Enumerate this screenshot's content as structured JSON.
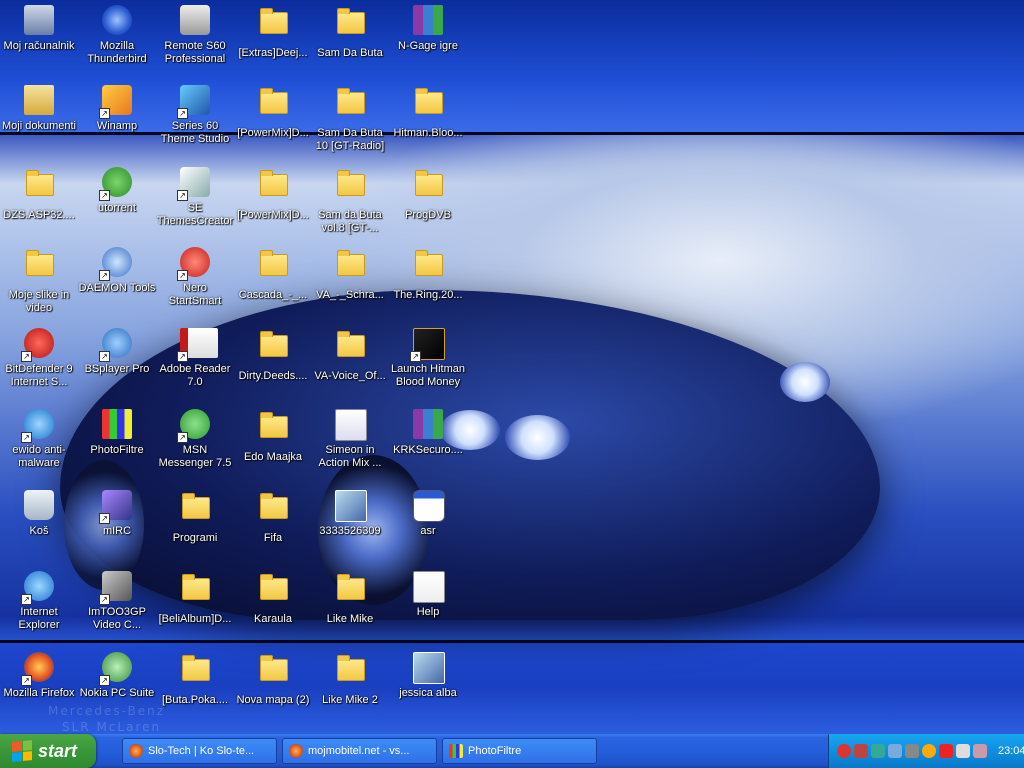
{
  "desktop": {
    "icons": [
      {
        "label": "Moj računalnik",
        "type": "computer"
      },
      {
        "label": "Mozilla Thunderbird",
        "type": "thunderbird"
      },
      {
        "label": "Remote S60 Professional",
        "type": "remote"
      },
      {
        "label": "[Extras]Deej...",
        "type": "folder"
      },
      {
        "label": "Sam Da Buta",
        "type": "folder"
      },
      {
        "label": "N-Gage igre",
        "type": "winrar"
      },
      {
        "label": "Moji dokumenti",
        "type": "docs"
      },
      {
        "label": "Winamp",
        "type": "winamp"
      },
      {
        "label": "Series 60 Theme Studio",
        "type": "theme"
      },
      {
        "label": "[PowerMix]D...",
        "type": "folder"
      },
      {
        "label": "Sam Da Buta 10 [GT-Radio]",
        "type": "folder"
      },
      {
        "label": "Hitman.Bloo...",
        "type": "folder"
      },
      {
        "label": "DZS.ASP32....",
        "type": "folder"
      },
      {
        "label": "utorrent",
        "type": "utorrent"
      },
      {
        "label": "SE ThemesCreator",
        "type": "se"
      },
      {
        "label": "[PowerMix]D...",
        "type": "folder"
      },
      {
        "label": "Sam da Buta vol.8 [GT-...",
        "type": "folder"
      },
      {
        "label": "ProgDVB",
        "type": "folder"
      },
      {
        "label": "Moje slike in video",
        "type": "folder"
      },
      {
        "label": "DAEMON Tools",
        "type": "daemon"
      },
      {
        "label": "Nero StartSmart",
        "type": "nero"
      },
      {
        "label": "Cascada_-_...",
        "type": "folder"
      },
      {
        "label": "VA_-_Schra...",
        "type": "folder"
      },
      {
        "label": "The.Ring.20...",
        "type": "folder"
      },
      {
        "label": "BitDefender 9 Internet S...",
        "type": "bitdefender"
      },
      {
        "label": "BSplayer Pro",
        "type": "bsplayer"
      },
      {
        "label": "Adobe Reader 7.0",
        "type": "adobe"
      },
      {
        "label": "Dirty.Deeds....",
        "type": "folder"
      },
      {
        "label": "VA-Voice_Of...",
        "type": "folder"
      },
      {
        "label": "Launch Hitman Blood Money",
        "type": "hitman"
      },
      {
        "label": "ewido anti-malware",
        "type": "ewido"
      },
      {
        "label": "PhotoFiltre",
        "type": "photofiltre"
      },
      {
        "label": "MSN Messenger 7.5",
        "type": "msn"
      },
      {
        "label": "Edo Maajka",
        "type": "folder"
      },
      {
        "label": "Simeon in Action Mix ...",
        "type": "doc"
      },
      {
        "label": "KRKSecuro....",
        "type": "winrar"
      },
      {
        "label": "Koš",
        "type": "recycle"
      },
      {
        "label": "mIRC",
        "type": "mirc"
      },
      {
        "label": "Programi",
        "type": "folder"
      },
      {
        "label": "Fifa",
        "type": "folder"
      },
      {
        "label": "3333526309",
        "type": "image"
      },
      {
        "label": "asr",
        "type": "window"
      },
      {
        "label": "Internet Explorer",
        "type": "ie"
      },
      {
        "label": "ImTOO3GP Video C...",
        "type": "imtoo"
      },
      {
        "label": "[BeliAlbum]D...",
        "type": "folder"
      },
      {
        "label": "Karaula",
        "type": "folder"
      },
      {
        "label": "Like Mike",
        "type": "folder"
      },
      {
        "label": "Help",
        "type": "textdoc"
      },
      {
        "label": "Mozilla Firefox",
        "type": "firefox"
      },
      {
        "label": "Nokia PC Suite",
        "type": "nokia"
      },
      {
        "label": "[Buta.Poka....",
        "type": "folder"
      },
      {
        "label": "Nova mapa (2)",
        "type": "folder"
      },
      {
        "label": "Like Mike 2",
        "type": "folder"
      },
      {
        "label": "jessica alba",
        "type": "image"
      }
    ]
  },
  "taskbar": {
    "start_label": "start",
    "tasks": [
      {
        "label": "Slo-Tech | Ko Slo-te...",
        "icon": "firefox-icon"
      },
      {
        "label": "mojmobitel.net - vs...",
        "icon": "firefox-icon"
      },
      {
        "label": "PhotoFiltre",
        "icon": "photofiltre-icon"
      }
    ],
    "clock": "23:04"
  },
  "wallpaper": {
    "watermark_line1": "Mercedes-Benz",
    "watermark_line2": "SLR McLaren"
  }
}
